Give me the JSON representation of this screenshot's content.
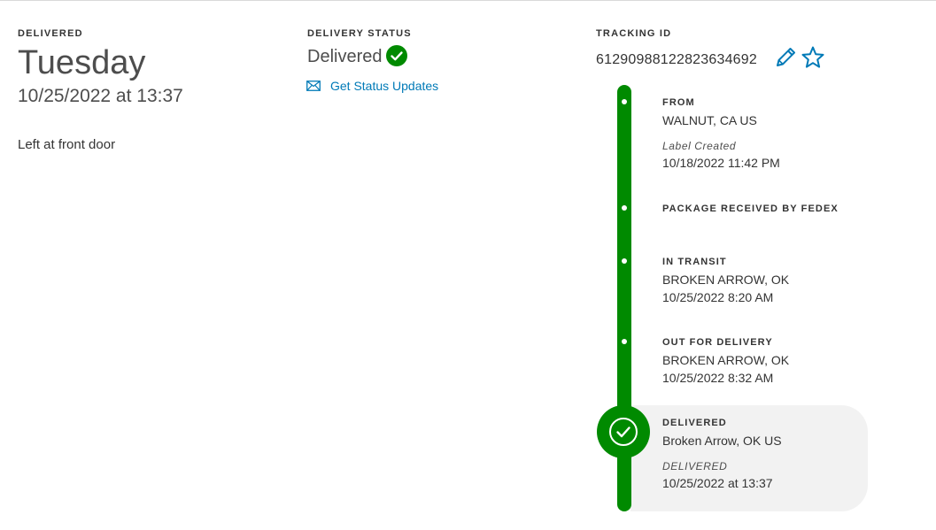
{
  "delivered": {
    "label": "DELIVERED",
    "day": "Tuesday",
    "datetime": "10/25/2022 at 13:37",
    "note": "Left at front door"
  },
  "delivery_status": {
    "label": "DELIVERY STATUS",
    "status": "Delivered",
    "updates_link": "Get Status Updates"
  },
  "tracking": {
    "label": "TRACKING ID",
    "id": "612909881228236346​92"
  },
  "timeline": {
    "events": [
      {
        "heading": "FROM",
        "location": "WALNUT, CA US",
        "info": "Label Created",
        "time": "10/18/2022 11:42 PM"
      },
      {
        "heading": "PACKAGE RECEIVED BY FEDEX"
      },
      {
        "heading": "IN TRANSIT",
        "location": "BROKEN ARROW, OK",
        "time": "10/25/2022 8:20 AM"
      },
      {
        "heading": "OUT FOR DELIVERY",
        "location": "BROKEN ARROW, OK",
        "time": "10/25/2022 8:32 AM"
      },
      {
        "heading": "DELIVERED",
        "location": "Broken Arrow, OK US",
        "info": "DELIVERED",
        "time": "10/25/2022 at 13:37"
      }
    ]
  },
  "colors": {
    "brand_green": "#008a00",
    "link_blue": "#007ab7",
    "highlight_bg": "#f2f2f2"
  },
  "icons": {
    "status": "check-circle-icon",
    "updates": "envelope-icon",
    "edit": "pencil-icon",
    "favorite": "star-icon",
    "delivered": "check-circle-icon"
  }
}
